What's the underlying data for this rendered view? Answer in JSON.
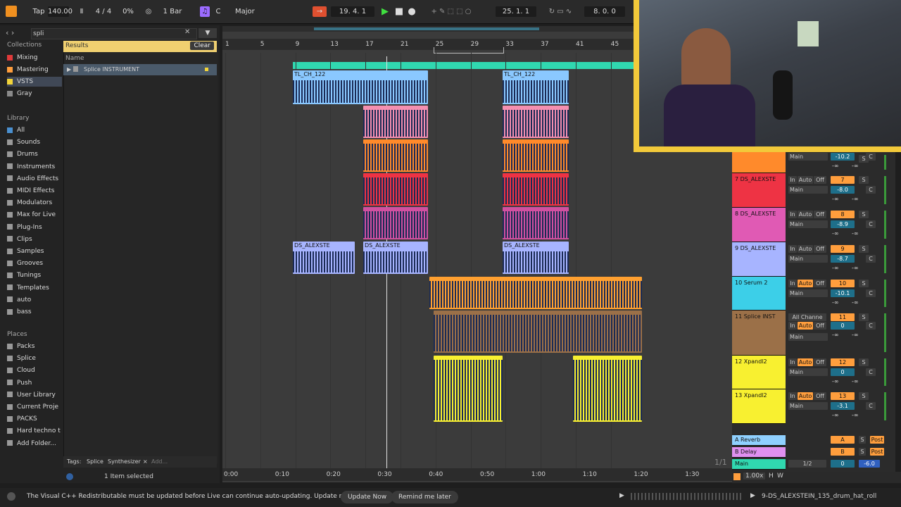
{
  "transport": {
    "tap": "Tap",
    "tempo": "140.00",
    "time_sig": "4 / 4",
    "groove": "0%",
    "quantize": "1 Bar",
    "key": "C",
    "scale": "Major",
    "position": "19.   4.   1",
    "loop_start": "25.   1.   1",
    "loop_length": "8.   0.   0"
  },
  "browser": {
    "search_value": "spli",
    "collections_title": "Collections",
    "collections": [
      {
        "label": "Mixing",
        "color": "#e03a3a"
      },
      {
        "label": "Mastering",
        "color": "#ff9e3d"
      },
      {
        "label": "VSTS",
        "color": "#f2d43a"
      },
      {
        "label": "Gray",
        "color": "#8a8a8a"
      }
    ],
    "library_title": "Library",
    "library": [
      "All",
      "Sounds",
      "Drums",
      "Instruments",
      "Audio Effects",
      "MIDI Effects",
      "Modulators",
      "Max for Live",
      "Plug-Ins",
      "Clips",
      "Samples",
      "Grooves",
      "Tunings",
      "Templates",
      "auto",
      "bass"
    ],
    "places_title": "Places",
    "places": [
      "Packs",
      "Splice",
      "Cloud",
      "Push",
      "User Library",
      "Current Proje",
      "PACKS",
      "Hard techno t",
      "Add Folder..."
    ],
    "results_label": "Results",
    "clear_label": "Clear",
    "name_header": "Name",
    "result_item": "Splice INSTRUMENT",
    "tags_label": "Tags:",
    "tags": [
      "Splice",
      "Synthesizer"
    ],
    "tag_add": "Add...",
    "selection_info": "1 Item selected"
  },
  "arrangement": {
    "bar_numbers": [
      "1",
      "5",
      "9",
      "13",
      "17",
      "21",
      "25",
      "29",
      "33",
      "37",
      "41",
      "45"
    ],
    "time_marks": [
      "0:00",
      "0:10",
      "0:20",
      "0:30",
      "0:40",
      "0:50",
      "1:00",
      "1:10",
      "1:20",
      "1:30"
    ],
    "clip_name_1": "TL_CH_122",
    "clip_name_2": "DS_ALEXSTE",
    "page_indicator": "1/1"
  },
  "mixer": {
    "tracks": [
      {
        "name": "",
        "color": "#ff8a2b",
        "num": "",
        "vol": "-10.2",
        "out": "Main"
      },
      {
        "name": "7 DS_ALEXSTE",
        "color": "#ee3344",
        "num": "7",
        "vol": "-8.0",
        "out": "Main"
      },
      {
        "name": "8 DS_ALEXSTE",
        "color": "#e05ab4",
        "num": "8",
        "vol": "-8.9",
        "out": "Main"
      },
      {
        "name": "9 DS_ALEXSTE",
        "color": "#a7b4ff",
        "num": "9",
        "vol": "-8.7",
        "out": "Main"
      },
      {
        "name": "10 Serum 2",
        "color": "#3ccfe8",
        "num": "10",
        "vol": "-10.1",
        "out": "Main"
      },
      {
        "name": "11 Splice INST",
        "color": "#9b7048",
        "num": "11",
        "vol": "0",
        "out": "Main",
        "input": "All Channe"
      },
      {
        "name": "12 Xpandl2",
        "color": "#f8f030",
        "num": "12",
        "vol": "0",
        "out": "Main"
      },
      {
        "name": "13 Xpandl2",
        "color": "#f8f030",
        "num": "13",
        "vol": "-3.1",
        "out": "Main"
      }
    ],
    "returns": [
      {
        "name": "A Reverb",
        "letter": "A",
        "color": "#8fd0ff"
      },
      {
        "name": "B Delay",
        "letter": "B",
        "color": "#e090f0"
      }
    ],
    "main_name": "Main",
    "main_out": "1/2",
    "main_send": "0",
    "main_vol": "-6.0",
    "in_label": "In",
    "auto_label": "Auto",
    "off_label": "Off",
    "s_label": "S",
    "c_label": "C",
    "post_label": "Post",
    "neg_inf": "-∞"
  },
  "bottom": {
    "zoom": "1.00x",
    "h": "H",
    "w": "W",
    "clip_title": "9-DS_ALEXSTEIN_135_drum_hat_roll"
  },
  "status": {
    "message": "The Visual C++ Redistributable must be updated before Live can continue auto-updating. Update now to proceed.",
    "update_now": "Update Now",
    "remind_later": "Remind me later"
  }
}
